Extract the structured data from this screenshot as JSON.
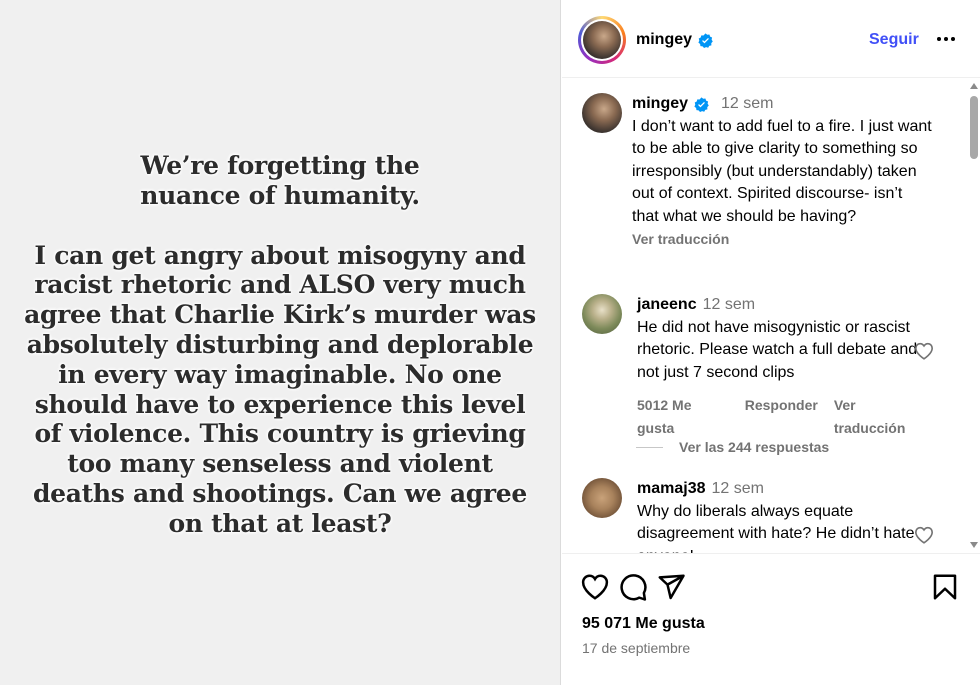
{
  "post_image": {
    "paragraphs": [
      "We’re forgetting the nuance of humanity.",
      "I can get angry about misogyny and racist rhetoric and ALSO very much agree that Charlie Kirk’s murder was absolutely disturbing and deplorable in every way imaginable. No one should have to experience this level of violence. This country is grieving too many senseless and violent deaths and shootings. Can we agree on that at least?"
    ]
  },
  "header": {
    "username": "mingey",
    "verified_icon": "verified-badge-icon",
    "follow_label": "Seguir",
    "more_icon": "more-options-icon"
  },
  "caption": {
    "username": "mingey",
    "time": "12 sem",
    "text": "I don’t want to add fuel to a fire. I just want to be able to give clarity to something so irresponsibly (but understandably) taken out of context. Spirited discourse- isn’t that what we should be having?",
    "translate": "Ver traducción"
  },
  "comments": [
    {
      "username": "janeenc",
      "time": "12 sem",
      "text": "He did not have misogynistic or rascist rhetoric. Please watch a full debate and not just 7 second clips",
      "likes": "5012 Me gusta",
      "reply": "Responder",
      "translate": "Ver traducción",
      "view_replies": "Ver las 244 respuestas"
    },
    {
      "username": "mamaj38",
      "time": "12 sem",
      "text": "Why do liberals always equate disagreement with hate? He didn’t hate anyone!"
    }
  ],
  "footer": {
    "icons": [
      "heart-icon",
      "comment-icon",
      "share-icon",
      "bookmark-icon"
    ],
    "likes": "95 071 Me gusta",
    "date": "17 de septiembre"
  },
  "colors": {
    "accent": "#4150f7",
    "verified": "#0095f6",
    "secondary_text": "#737373",
    "image_bg": "#f0f0f0"
  }
}
